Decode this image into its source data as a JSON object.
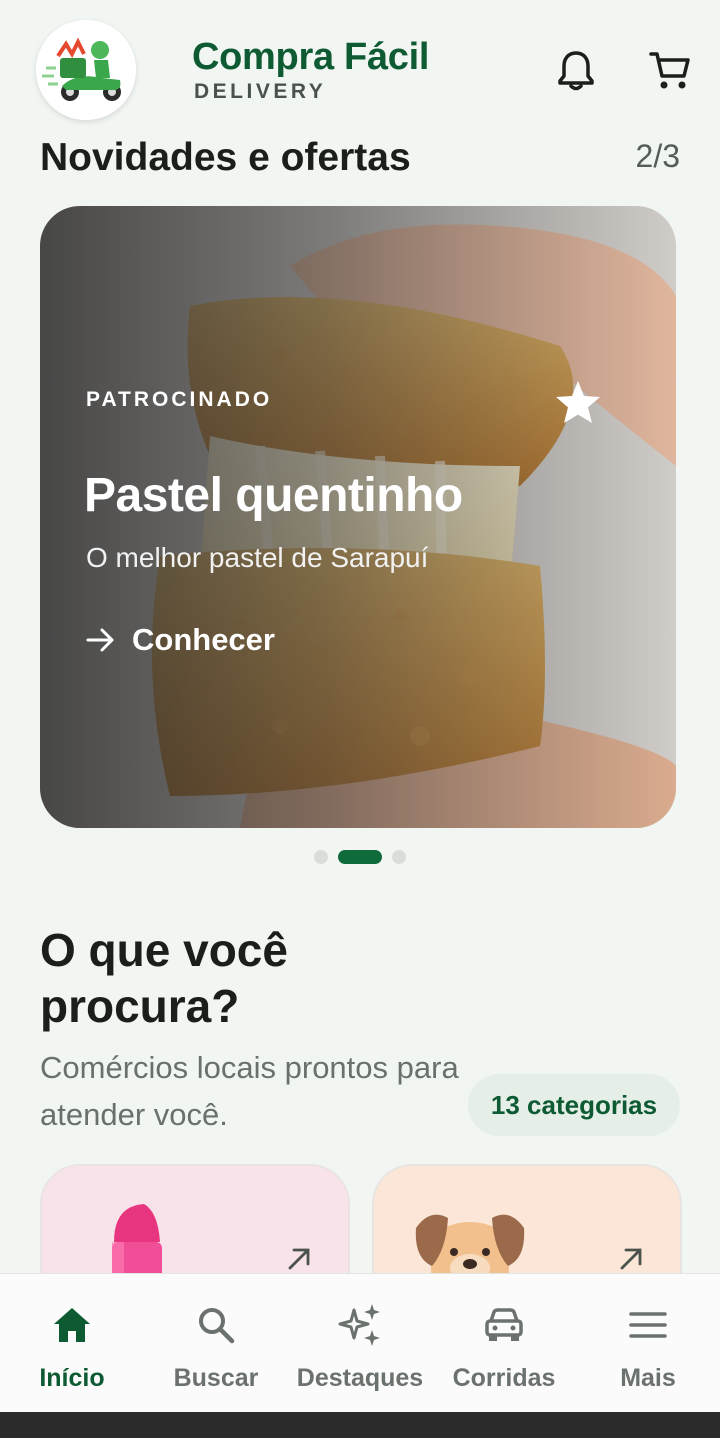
{
  "header": {
    "brand_title": "Compra Fácil",
    "brand_subtitle": "DELIVERY",
    "icons": [
      "notification-bell-icon",
      "shopping-cart-icon"
    ]
  },
  "offers": {
    "title": "Novidades e ofertas",
    "pager": "2/3",
    "banner": {
      "tag": "PATROCINADO",
      "title": "Pastel quentinho",
      "subtitle": "O melhor pastel de Sarapuí",
      "cta": "Conhecer"
    },
    "active_slide": 2,
    "slide_count": 3
  },
  "categories": {
    "title": "O que você procura?",
    "subtitle": "Comércios locais prontos para atender você.",
    "count_chip": "13 categorias",
    "cards": [
      {
        "icon": "lipstick-icon",
        "color": "#f9e3ea"
      },
      {
        "icon": "dog-icon",
        "color": "#fbe6d7"
      }
    ]
  },
  "nav": {
    "items": [
      {
        "label": "Início",
        "icon": "home-icon",
        "active": true
      },
      {
        "label": "Buscar",
        "icon": "search-icon",
        "active": false
      },
      {
        "label": "Destaques",
        "icon": "sparkles-icon",
        "active": false
      },
      {
        "label": "Corridas",
        "icon": "car-icon",
        "active": false
      },
      {
        "label": "Mais",
        "icon": "menu-icon",
        "active": false
      }
    ]
  },
  "colors": {
    "brand_green": "#0d5a33",
    "accent_green": "#0f6b3c",
    "background": "#f2f6f2"
  }
}
